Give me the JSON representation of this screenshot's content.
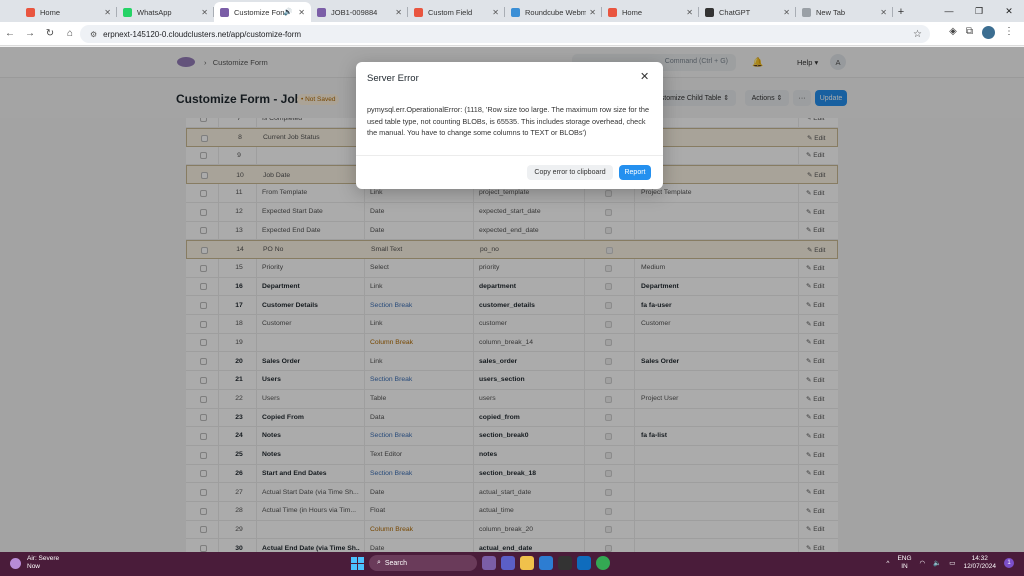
{
  "browser": {
    "tabs": [
      {
        "label": "Home",
        "active": false,
        "color": "#e9553f"
      },
      {
        "label": "WhatsApp",
        "active": false,
        "color": "#25d366"
      },
      {
        "label": "Customize Form",
        "active": true,
        "color": "#7b5ea7"
      },
      {
        "label": "JOB1-009884",
        "active": false,
        "color": "#7b5ea7"
      },
      {
        "label": "Custom Field",
        "active": false,
        "color": "#e9553f"
      },
      {
        "label": "Roundcube Webmail",
        "active": false,
        "color": "#3b8fd6"
      },
      {
        "label": "Home",
        "active": false,
        "color": "#e9553f"
      },
      {
        "label": "ChatGPT",
        "active": false,
        "color": "#333333"
      },
      {
        "label": "New Tab",
        "active": false,
        "color": "#9aa0a6"
      }
    ],
    "url": "erpnext-145120-0.cloudclusters.net/app/customize-form"
  },
  "app": {
    "breadcrumb": "Customize Form",
    "search_placeholder": "Command (Ctrl + G)",
    "help_label": "Help",
    "avatar_letter": "A"
  },
  "page": {
    "title": "Customize Form - Job",
    "status": "• Not Saved",
    "customize_child_label": "ustomize Child Table",
    "actions_label": "Actions",
    "more_label": "···",
    "update_label": "Update"
  },
  "table": {
    "edit_label": "✎ Edit",
    "rows": [
      {
        "num": "7",
        "label": "Is Completed",
        "type": "",
        "fieldname": "",
        "options": "",
        "bold": false,
        "hl": false
      },
      {
        "num": "8",
        "label": "Current Job Status",
        "type": "",
        "fieldname": "",
        "options": "",
        "bold": false,
        "hl": true
      },
      {
        "num": "9",
        "label": "",
        "type": "",
        "fieldname": "",
        "options": "",
        "bold": false,
        "hl": false
      },
      {
        "num": "10",
        "label": "Job Date",
        "type": "",
        "fieldname": "",
        "options": "",
        "bold": false,
        "hl": true
      },
      {
        "num": "11",
        "label": "From Template",
        "type": "Link",
        "fieldname": "project_template",
        "options": "Project Template",
        "bold": false,
        "hl": false
      },
      {
        "num": "12",
        "label": "Expected Start Date",
        "type": "Date",
        "fieldname": "expected_start_date",
        "options": "",
        "bold": false,
        "hl": false
      },
      {
        "num": "13",
        "label": "Expected End Date",
        "type": "Date",
        "fieldname": "expected_end_date",
        "options": "",
        "bold": false,
        "hl": false
      },
      {
        "num": "14",
        "label": "PO No",
        "type": "Small Text",
        "fieldname": "po_no",
        "options": "",
        "bold": false,
        "hl": true
      },
      {
        "num": "15",
        "label": "Priority",
        "type": "Select",
        "fieldname": "priority",
        "options": "Medium",
        "bold": false,
        "hl": false
      },
      {
        "num": "16",
        "label": "Department",
        "type": "Link",
        "fieldname": "department",
        "options": "Department",
        "bold": true,
        "hl": false
      },
      {
        "num": "17",
        "label": "Customer Details",
        "type": "Section Break",
        "fieldname": "customer_details",
        "options": "fa fa-user",
        "bold": true,
        "hl": false
      },
      {
        "num": "18",
        "label": "Customer",
        "type": "Link",
        "fieldname": "customer",
        "options": "Customer",
        "bold": false,
        "hl": false
      },
      {
        "num": "19",
        "label": "",
        "type": "Column Break",
        "fieldname": "column_break_14",
        "options": "",
        "bold": false,
        "hl": false
      },
      {
        "num": "20",
        "label": "Sales Order",
        "type": "Link",
        "fieldname": "sales_order",
        "options": "Sales Order",
        "bold": true,
        "hl": false
      },
      {
        "num": "21",
        "label": "Users",
        "type": "Section Break",
        "fieldname": "users_section",
        "options": "",
        "bold": true,
        "hl": false
      },
      {
        "num": "22",
        "label": "Users",
        "type": "Table",
        "fieldname": "users",
        "options": "Project User",
        "bold": false,
        "hl": false
      },
      {
        "num": "23",
        "label": "Copied From",
        "type": "Data",
        "fieldname": "copied_from",
        "options": "",
        "bold": true,
        "hl": false
      },
      {
        "num": "24",
        "label": "Notes",
        "type": "Section Break",
        "fieldname": "section_break0",
        "options": "fa fa-list",
        "bold": true,
        "hl": false
      },
      {
        "num": "25",
        "label": "Notes",
        "type": "Text Editor",
        "fieldname": "notes",
        "options": "",
        "bold": true,
        "hl": false
      },
      {
        "num": "26",
        "label": "Start and End Dates",
        "type": "Section Break",
        "fieldname": "section_break_18",
        "options": "",
        "bold": true,
        "hl": false
      },
      {
        "num": "27",
        "label": "Actual Start Date (via Time Sh...",
        "type": "Date",
        "fieldname": "actual_start_date",
        "options": "",
        "bold": false,
        "hl": false
      },
      {
        "num": "28",
        "label": "Actual Time (in Hours via Tim...",
        "type": "Float",
        "fieldname": "actual_time",
        "options": "",
        "bold": false,
        "hl": false
      },
      {
        "num": "29",
        "label": "",
        "type": "Column Break",
        "fieldname": "column_break_20",
        "options": "",
        "bold": false,
        "hl": false
      },
      {
        "num": "30",
        "label": "Actual End Date (via Time Sh...",
        "type": "Date",
        "fieldname": "actual_end_date",
        "options": "",
        "bold": true,
        "hl": false
      }
    ]
  },
  "modal": {
    "title": "Server Error",
    "message": "pymysql.err.OperationalError: (1118, 'Row size too large. The maximum row size for the used table type, not counting BLOBs, is 65535. This includes storage overhead, check the manual. You have to change some columns to TEXT or BLOBs')",
    "copy_label": "Copy error to clipboard",
    "report_label": "Report"
  },
  "taskbar": {
    "weather_title": "Air: Severe",
    "weather_sub": "Now",
    "search_label": "Search",
    "lang": "ENG",
    "region": "IN",
    "time": "14:32",
    "date": "12/07/2024",
    "notif": "1"
  }
}
